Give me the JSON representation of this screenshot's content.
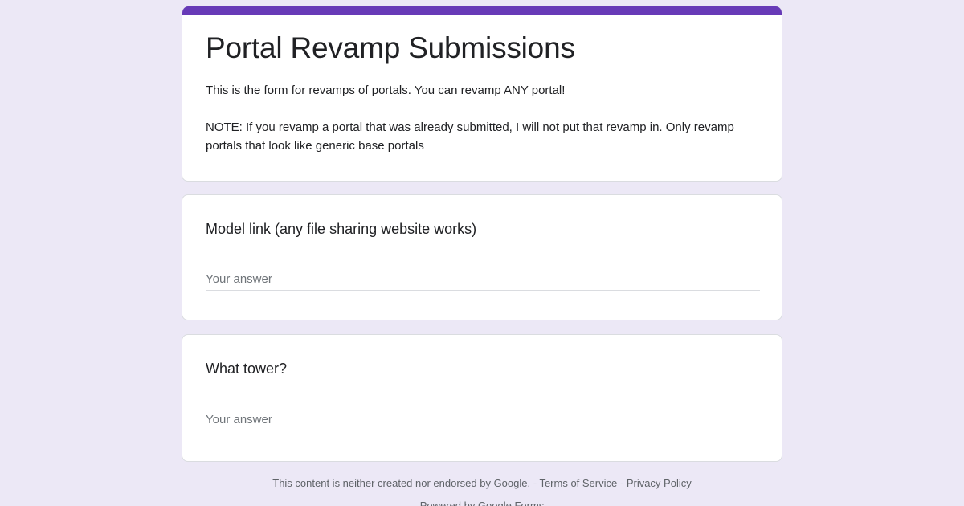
{
  "form": {
    "title": "Portal Revamp Submissions",
    "description_line1": "This is the form for revamps of portals. You can revamp ANY portal!",
    "description_line2": "NOTE: If you revamp a portal that was already submitted, I will not put that revamp in. Only revamp portals that look like generic base portals",
    "accent_color": "#673ab7",
    "background_color": "#ece8f6"
  },
  "questions": [
    {
      "title": "Model link (any file sharing website works)",
      "placeholder": "Your answer"
    },
    {
      "title": "What tower?",
      "placeholder": "Your answer"
    }
  ],
  "footer": {
    "disclaimer": "This content is neither created nor endorsed by Google.",
    "separator": " - ",
    "terms_label": "Terms of Service",
    "privacy_label": "Privacy Policy",
    "powered_by": "Powered by Google Forms"
  }
}
